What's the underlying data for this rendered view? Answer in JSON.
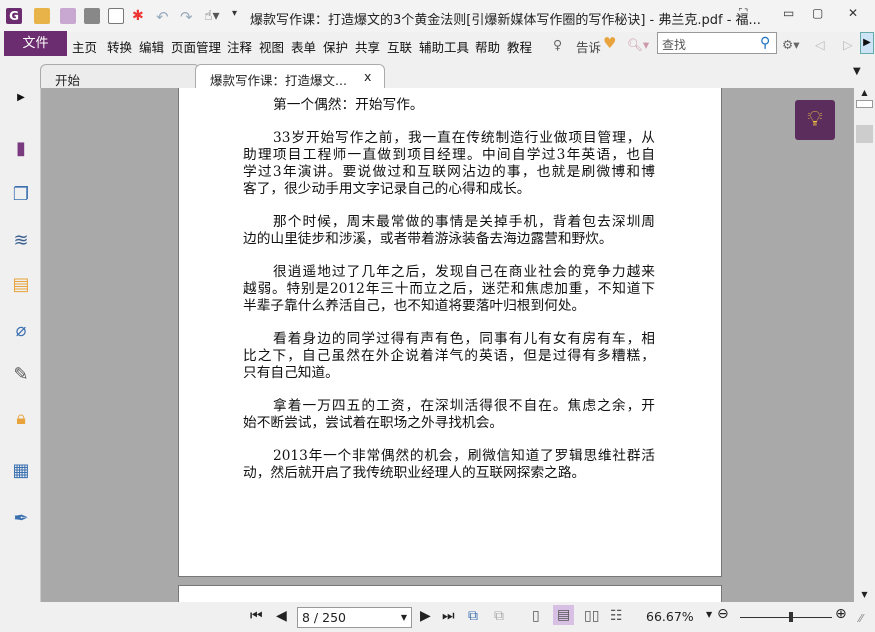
{
  "window": {
    "title": "爆款写作课：打造爆文的3个黄金法则[引爆新媒体写作圈的写作秘诀] - 弗兰克.pdf - 福..."
  },
  "menu": {
    "file": "文件",
    "items": [
      "主页",
      "转换",
      "编辑",
      "页面管理",
      "注释",
      "视图",
      "表单",
      "保护",
      "共享",
      "互联",
      "辅助工具",
      "帮助",
      "教程"
    ],
    "tell": "告诉",
    "search_placeholder": "查找"
  },
  "tabs": [
    {
      "label": "开始"
    },
    {
      "label": "爆款写作课：打造爆文...",
      "close": "x"
    }
  ],
  "document": {
    "paragraphs": [
      [
        "第一个偶然：开始写作。"
      ],
      [
        "33岁开始写作之前，我一直在传统制造行业做项目管理，从",
        "助理项目工程师一直做到项目经理。中间自学过3年英语，也自",
        "学过3年演讲。要说做过和互联网沾边的事，也就是刷微博和博",
        "客了，很少动手用文字记录自己的心得和成长。"
      ],
      [
        "那个时候，周末最常做的事情是关掉手机，背着包去深圳周",
        "边的山里徒步和涉溪，或者带着游泳装备去海边露营和野炊。"
      ],
      [
        "很逍遥地过了几年之后，发现自己在商业社会的竞争力越来",
        "越弱。特别是2012年三十而立之后，迷茫和焦虑加重，不知道下",
        "半辈子靠什么养活自己，也不知道将要落叶归根到何处。"
      ],
      [
        "看着身边的同学过得有声有色，同事有儿有女有房有车，相",
        "比之下，自己虽然在外企说着洋气的英语，但是过得有多糟糕，",
        "只有自己知道。"
      ],
      [
        "拿着一万四五的工资，在深圳活得很不自在。焦虑之余，开",
        "始不断尝试，尝试着在职场之外寻找机会。"
      ],
      [
        "2013年一个非常偶然的机会，刷微信知道了罗辑思维社群活",
        "动，然后就开启了我传统职业经理人的互联网探索之路。"
      ]
    ]
  },
  "status": {
    "page": "8 / 250",
    "zoom": "66.67%",
    "zoom_fraction": 0.55
  },
  "colors": {
    "accent": "#6b2d6f",
    "tip": "#5b2d5d"
  }
}
